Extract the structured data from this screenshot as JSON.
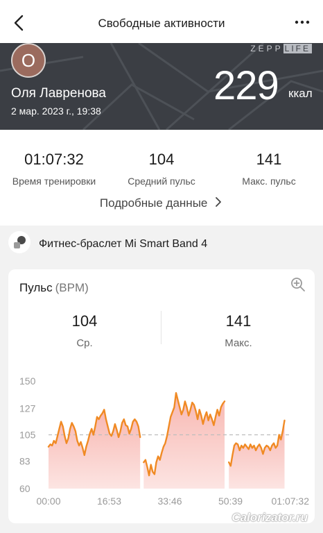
{
  "header": {
    "title": "Свободные активности",
    "back_icon": "chevron-left-icon",
    "more_icon": "more-horizontal-icon"
  },
  "banner": {
    "brand": "ZEPP",
    "brand_suffix": "LIFE",
    "avatar_initial": "О",
    "user_name": "Оля Лавренова",
    "date": "2 мар. 2023 г., 19:38",
    "calories": "229",
    "calories_unit": "ккал"
  },
  "stats": [
    {
      "value": "01:07:32",
      "label": "Время тренировки"
    },
    {
      "value": "104",
      "label": "Средний пульс"
    },
    {
      "value": "141",
      "label": "Макс. пульс"
    }
  ],
  "details_link": "Подробные данные",
  "device": {
    "name": "Фитнес-браслет Mi Smart Band 4",
    "icon": "band-icon"
  },
  "heart_card": {
    "title": "Пульс",
    "unit": "(BPM)",
    "zoom_icon": "zoom-in-icon",
    "avg_value": "104",
    "avg_label": "Ср.",
    "max_value": "141",
    "max_label": "Макс."
  },
  "chart_data": {
    "type": "area",
    "title": "",
    "xlabel": "",
    "ylabel": "",
    "ylim": [
      60,
      150
    ],
    "yticks": [
      "150",
      "127",
      "105",
      "83",
      "60"
    ],
    "ytick_values": [
      150,
      127,
      105,
      83,
      60
    ],
    "xticks": [
      "00:00",
      "16:53",
      "33:46",
      "50:39",
      "01:07:32"
    ],
    "xtick_values": [
      0,
      16.88,
      33.77,
      50.65,
      67.53
    ],
    "xlim": [
      0,
      67.53
    ],
    "reference_line": 105,
    "line_color": "#f08a24",
    "fill_color": "#f7b3ad",
    "segments": [
      [
        [
          0.0,
          95
        ],
        [
          0.5,
          97
        ],
        [
          1.0,
          96
        ],
        [
          1.5,
          100
        ],
        [
          2.0,
          98
        ],
        [
          2.5,
          104
        ],
        [
          3.0,
          110
        ],
        [
          3.5,
          116
        ],
        [
          4.0,
          112
        ],
        [
          4.5,
          104
        ],
        [
          5.0,
          98
        ],
        [
          5.5,
          102
        ],
        [
          6.0,
          110
        ],
        [
          6.5,
          115
        ],
        [
          7.0,
          112
        ],
        [
          7.5,
          108
        ],
        [
          8.0,
          100
        ],
        [
          8.5,
          96
        ],
        [
          9.0,
          99
        ],
        [
          9.5,
          94
        ],
        [
          10.0,
          88
        ],
        [
          10.5,
          95
        ],
        [
          11.0,
          100
        ],
        [
          11.5,
          106
        ],
        [
          12.0,
          110
        ],
        [
          12.5,
          105
        ],
        [
          13.0,
          112
        ],
        [
          13.5,
          120
        ],
        [
          14.0,
          118
        ],
        [
          14.5,
          121
        ],
        [
          15.0,
          123
        ],
        [
          15.5,
          126
        ],
        [
          16.0,
          118
        ],
        [
          16.5,
          112
        ],
        [
          17.0,
          106
        ],
        [
          17.5,
          104
        ],
        [
          18.0,
          108
        ],
        [
          18.5,
          114
        ],
        [
          19.0,
          109
        ],
        [
          19.5,
          103
        ],
        [
          20.0,
          108
        ],
        [
          20.5,
          115
        ],
        [
          21.0,
          118
        ],
        [
          21.5,
          113
        ],
        [
          22.0,
          112
        ],
        [
          22.5,
          106
        ],
        [
          23.0,
          110
        ],
        [
          23.5,
          116
        ],
        [
          24.0,
          118
        ],
        [
          24.5,
          116
        ],
        [
          25.0,
          112
        ],
        [
          25.5,
          103
        ]
      ],
      [
        [
          26.5,
          82
        ],
        [
          27.0,
          84
        ],
        [
          27.5,
          78
        ],
        [
          28.0,
          71
        ],
        [
          28.5,
          80
        ],
        [
          29.0,
          74
        ],
        [
          29.5,
          72
        ],
        [
          30.0,
          82
        ],
        [
          30.5,
          87
        ],
        [
          31.0,
          84
        ],
        [
          31.5,
          90
        ],
        [
          32.0,
          95
        ],
        [
          32.5,
          98
        ],
        [
          33.0,
          104
        ],
        [
          33.5,
          112
        ],
        [
          34.0,
          120
        ],
        [
          34.5,
          124
        ],
        [
          35.0,
          128
        ],
        [
          35.5,
          140
        ],
        [
          36.0,
          134
        ],
        [
          36.5,
          128
        ],
        [
          37.0,
          122
        ],
        [
          37.5,
          126
        ],
        [
          38.0,
          133
        ],
        [
          38.5,
          128
        ],
        [
          39.0,
          121
        ],
        [
          39.5,
          126
        ],
        [
          40.0,
          132
        ],
        [
          40.5,
          130
        ],
        [
          41.0,
          125
        ],
        [
          41.5,
          118
        ],
        [
          42.0,
          126
        ],
        [
          42.5,
          121
        ],
        [
          43.0,
          114
        ],
        [
          43.5,
          120
        ],
        [
          44.0,
          124
        ],
        [
          44.5,
          117
        ],
        [
          45.0,
          122
        ],
        [
          45.5,
          118
        ],
        [
          46.0,
          113
        ],
        [
          46.5,
          120
        ],
        [
          47.0,
          126
        ],
        [
          47.5,
          121
        ],
        [
          48.0,
          128
        ],
        [
          48.5,
          131
        ],
        [
          49.0,
          133
        ]
      ],
      [
        [
          50.2,
          82
        ],
        [
          50.7,
          79
        ],
        [
          51.2,
          88
        ],
        [
          51.7,
          96
        ],
        [
          52.2,
          98
        ],
        [
          52.7,
          97
        ],
        [
          53.2,
          92
        ],
        [
          53.7,
          96
        ],
        [
          54.2,
          94
        ],
        [
          54.7,
          97
        ],
        [
          55.2,
          95
        ],
        [
          55.7,
          93
        ],
        [
          56.2,
          97
        ],
        [
          56.7,
          94
        ],
        [
          57.2,
          96
        ],
        [
          57.7,
          92
        ],
        [
          58.2,
          95
        ],
        [
          58.7,
          97
        ],
        [
          59.2,
          94
        ],
        [
          59.7,
          89
        ],
        [
          60.2,
          94
        ],
        [
          60.7,
          96
        ],
        [
          61.2,
          95
        ],
        [
          61.7,
          92
        ],
        [
          62.2,
          96
        ],
        [
          62.7,
          98
        ],
        [
          63.2,
          94
        ],
        [
          63.7,
          96
        ],
        [
          64.2,
          105
        ],
        [
          64.7,
          101
        ],
        [
          65.2,
          108
        ],
        [
          65.7,
          117
        ]
      ]
    ]
  }
}
